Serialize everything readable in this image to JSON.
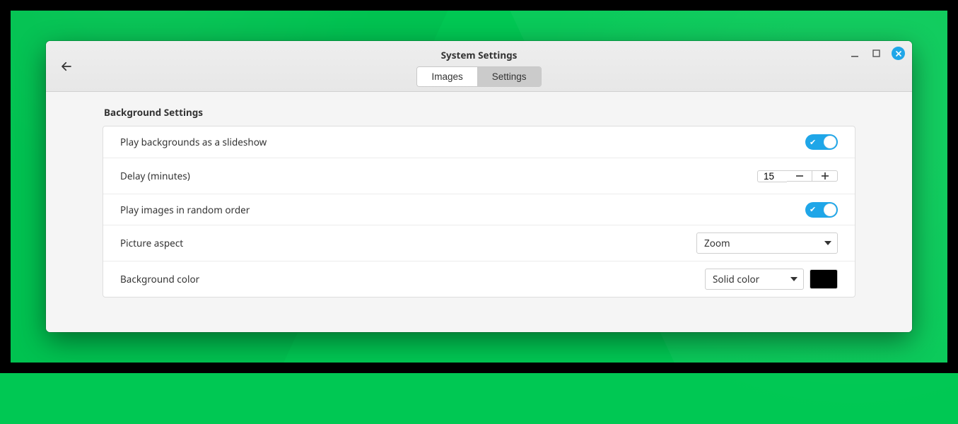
{
  "window": {
    "title": "System Settings"
  },
  "tabs": {
    "images": "Images",
    "settings": "Settings",
    "active": "settings"
  },
  "section": {
    "title": "Background Settings"
  },
  "rows": {
    "slideshow": {
      "label": "Play backgrounds as a slideshow",
      "value": true
    },
    "delay": {
      "label": "Delay (minutes)",
      "value": "15"
    },
    "random": {
      "label": "Play images in random order",
      "value": true
    },
    "aspect": {
      "label": "Picture aspect",
      "selected": "Zoom"
    },
    "bgcolor": {
      "label": "Background color",
      "selected": "Solid color",
      "swatch": "#000000"
    }
  }
}
